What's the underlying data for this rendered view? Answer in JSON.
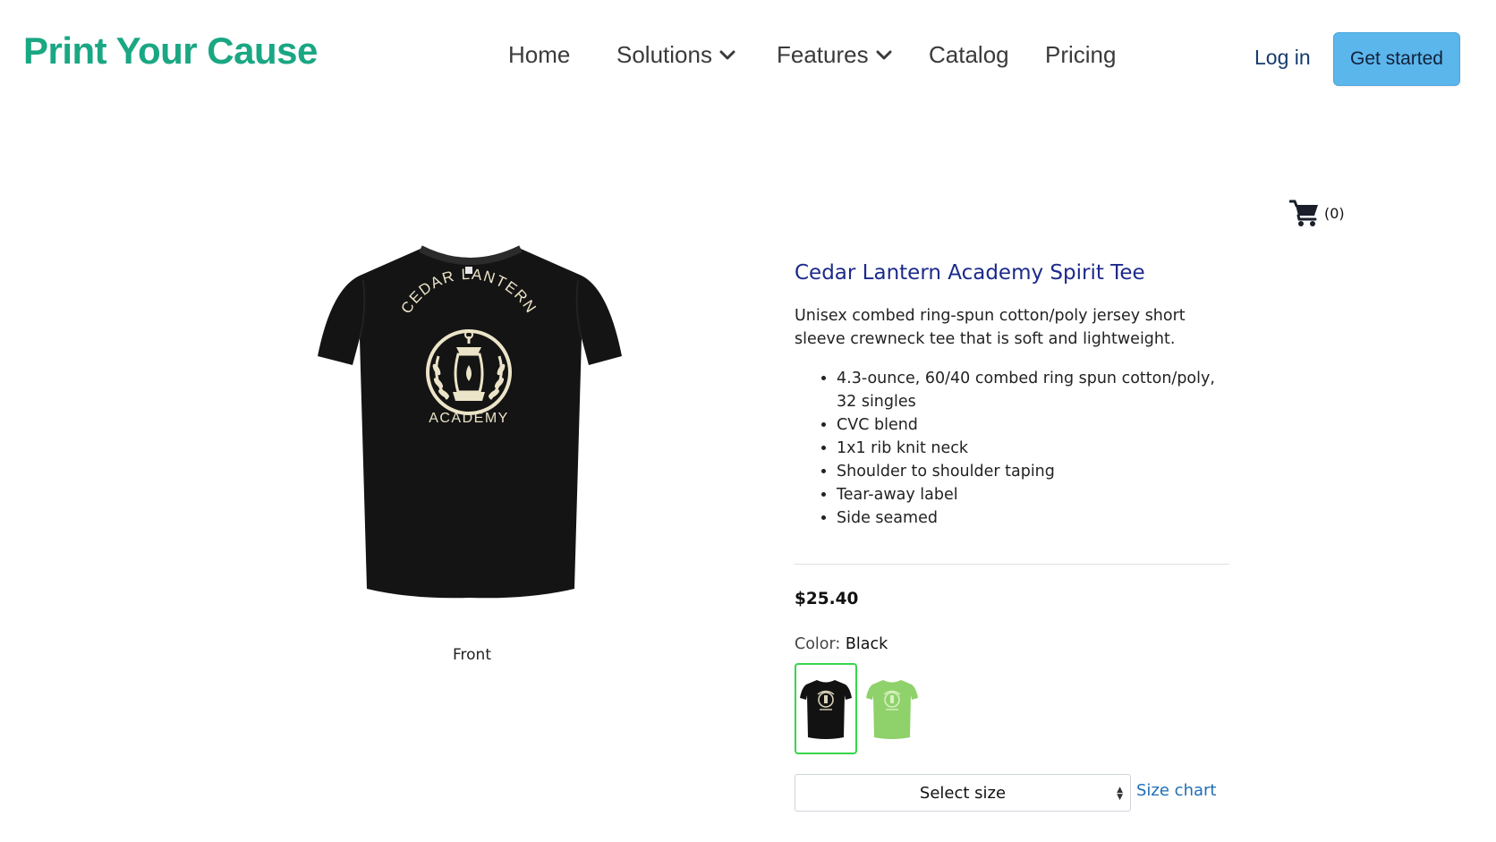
{
  "brand": {
    "name": "Print Your Cause",
    "color": "#1aa783"
  },
  "nav": {
    "items": [
      {
        "label": "Home",
        "has_dropdown": false
      },
      {
        "label": "Solutions",
        "has_dropdown": true
      },
      {
        "label": "Features",
        "has_dropdown": true
      },
      {
        "label": "Catalog",
        "has_dropdown": false
      },
      {
        "label": "Pricing",
        "has_dropdown": false
      }
    ],
    "login_label": "Log in",
    "cta_label": "Get started",
    "cta_color": "#5bb6ec"
  },
  "cart": {
    "icon": "shopping-cart-icon",
    "count_label": "(0)"
  },
  "product": {
    "image_caption": "Front",
    "shirt_print": {
      "top_text": "CEDAR LANTERN",
      "bottom_text": "ACADEMY"
    },
    "title": "Cedar Lantern Academy Spirit Tee",
    "description": "Unisex combed ring-spun cotton/poly jersey short sleeve crewneck tee that is soft and lightweight.",
    "features": [
      "4.3-ounce, 60/40 combed ring spun cotton/poly, 32 singles",
      "CVC blend",
      "1x1 rib knit neck",
      "Shoulder to shoulder taping",
      "Tear-away label",
      "Side seamed"
    ],
    "price": "$25.40",
    "color_label": "Color:",
    "color_value": "Black",
    "swatches": [
      {
        "name": "Black",
        "color": "#111111",
        "selected": true
      },
      {
        "name": "Green",
        "color": "#8fd16a",
        "selected": false
      }
    ],
    "size_select_label": "Select size",
    "size_chart_label": "Size chart"
  }
}
